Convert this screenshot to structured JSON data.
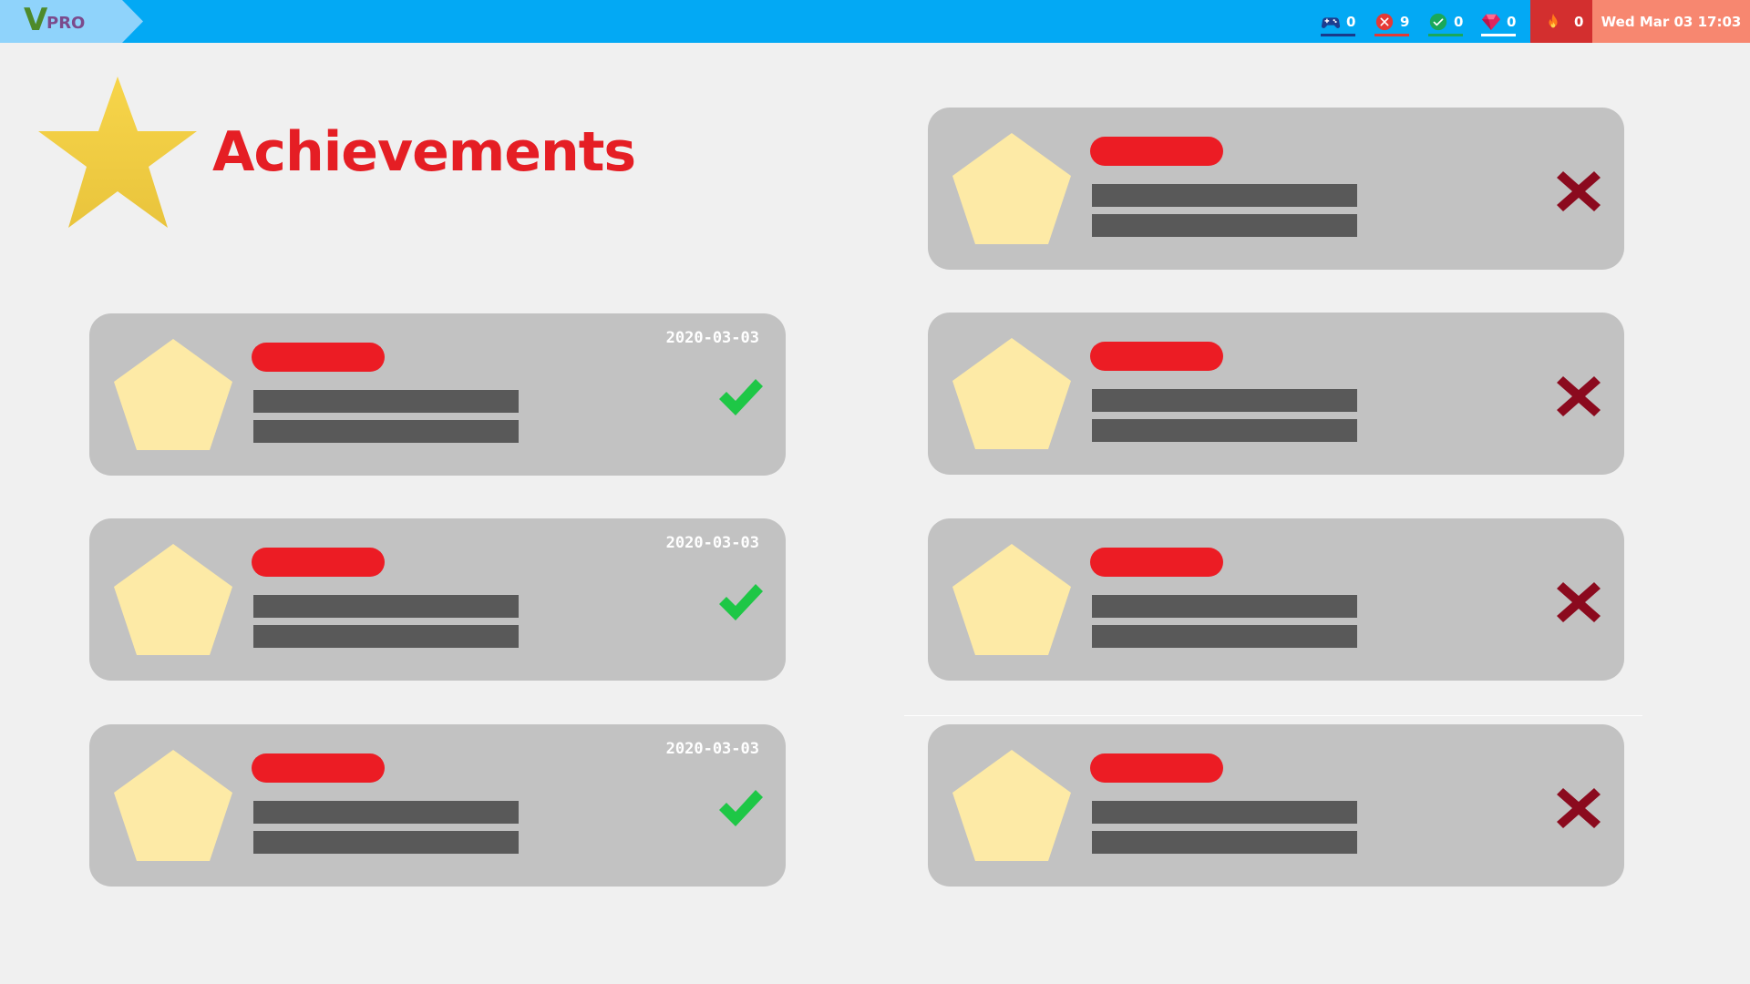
{
  "topbar": {
    "logo": {
      "v": "V",
      "pro": "PRO"
    },
    "stats": [
      {
        "name": "games",
        "icon": "gamepad-icon",
        "value": "0",
        "color": "#1a3a8a"
      },
      {
        "name": "failed",
        "icon": "x-circle-icon",
        "value": "9",
        "color": "#e53935"
      },
      {
        "name": "passed",
        "icon": "check-circle-icon",
        "value": "0",
        "color": "#1aa85a"
      },
      {
        "name": "gems",
        "icon": "gem-icon",
        "value": "0",
        "color": "#ffffff"
      }
    ],
    "streak": {
      "icon": "fire-icon",
      "value": "0"
    },
    "clock": "Wed Mar 03 17:03"
  },
  "page": {
    "title": "Achievements",
    "title_icon": "star-icon"
  },
  "achievements": [
    {
      "column": "left",
      "date": "2020-03-03",
      "status": "unlocked",
      "icon": "pentagon-icon"
    },
    {
      "column": "left",
      "date": "2020-03-03",
      "status": "unlocked",
      "icon": "pentagon-icon"
    },
    {
      "column": "left",
      "date": "2020-03-03",
      "status": "unlocked",
      "icon": "pentagon-icon"
    },
    {
      "column": "right",
      "date": "",
      "status": "locked",
      "icon": "pentagon-icon"
    },
    {
      "column": "right",
      "date": "",
      "status": "locked",
      "icon": "pentagon-icon"
    },
    {
      "column": "right",
      "date": "",
      "status": "locked",
      "icon": "pentagon-icon"
    },
    {
      "column": "right",
      "date": "",
      "status": "locked",
      "icon": "pentagon-icon"
    }
  ],
  "colors": {
    "topbar": "#03a9f4",
    "title": "#e51e24",
    "card": "#c2c2c2",
    "badge": "#fdeaa6",
    "check": "#1ec746",
    "cross": "#8b0a1e"
  }
}
